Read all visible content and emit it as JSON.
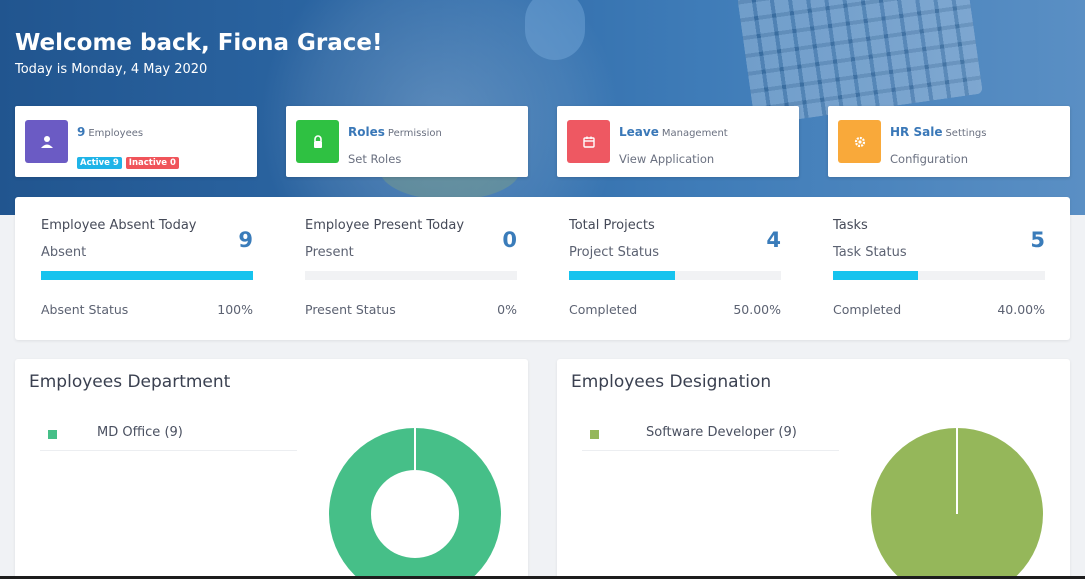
{
  "header": {
    "welcome": "Welcome back, Fiona Grace!",
    "date": "Today is Monday, 4 May 2020"
  },
  "quick_cards": [
    {
      "title": "9",
      "subtitle": "Employees",
      "icon": "user-icon",
      "color": "#6b5bc4",
      "badges": [
        {
          "label": "Active 9",
          "color": "#1fb4e8"
        },
        {
          "label": "Inactive 0",
          "color": "#f0545a"
        }
      ]
    },
    {
      "title": "Roles",
      "subtitle": "Permission",
      "line": "Set Roles",
      "icon": "lock-icon",
      "color": "#2fc142"
    },
    {
      "title": "Leave",
      "subtitle": "Management",
      "line": "View Application",
      "icon": "calendar-icon",
      "color": "#ee5862"
    },
    {
      "title": "HR Sale",
      "subtitle": "Settings",
      "line": "Configuration",
      "icon": "gear-icon",
      "color": "#f9a93a"
    }
  ],
  "stats": [
    {
      "title": "Employee Absent Today",
      "subtitle": "Absent",
      "value": "9",
      "progress": 1.0,
      "footer": "Absent Status",
      "percent": "100%"
    },
    {
      "title": "Employee Present Today",
      "subtitle": "Present",
      "value": "0",
      "progress": 0.0,
      "footer": "Present Status",
      "percent": "0%"
    },
    {
      "title": "Total Projects",
      "subtitle": "Project Status",
      "value": "4",
      "progress": 0.5,
      "footer": "Completed",
      "percent": "50.00%"
    },
    {
      "title": "Tasks",
      "subtitle": "Task Status",
      "value": "5",
      "progress": 0.4,
      "footer": "Completed",
      "percent": "40.00%"
    }
  ],
  "departments": {
    "title": "Employees Department",
    "legend": [
      {
        "label": "MD Office (9)",
        "color": "#46bf88"
      }
    ]
  },
  "designations": {
    "title": "Employees Designation",
    "legend": [
      {
        "label": "Software Developer (9)",
        "color": "#95b75a"
      }
    ]
  },
  "chart_data": [
    {
      "type": "pie",
      "variant": "donut",
      "labels": [
        "MD Office"
      ],
      "values": [
        9
      ],
      "colors": [
        "#46bf88"
      ]
    },
    {
      "type": "pie",
      "labels": [
        "Software Developer"
      ],
      "values": [
        9
      ],
      "colors": [
        "#95b75a"
      ]
    }
  ],
  "accent": "#3a7cba",
  "progress_color": "#16c3ee"
}
